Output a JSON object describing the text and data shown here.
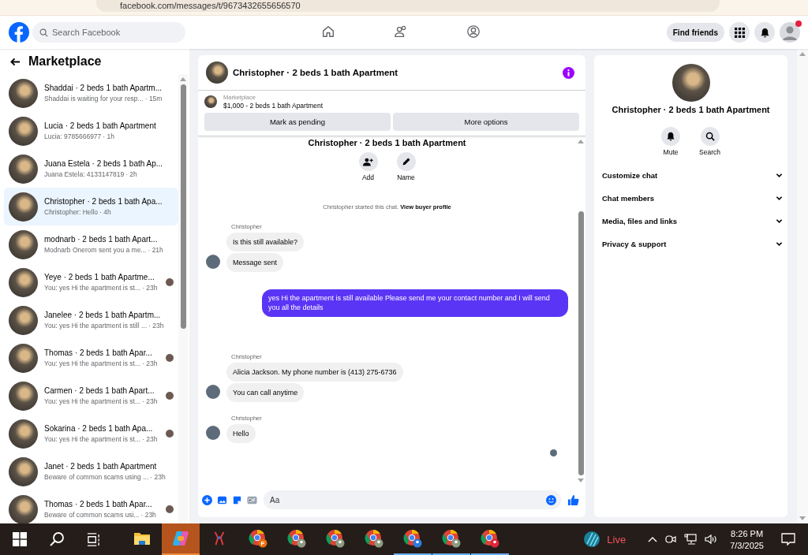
{
  "browser": {
    "url": "facebook.com/messages/t/9673432655656570"
  },
  "topbar": {
    "search": {
      "placeholder": "Search Facebook"
    },
    "nav": [
      {
        "selected": false
      },
      {
        "selected": false
      },
      {
        "selected": false
      }
    ],
    "find_friends": "Find friends",
    "notification_dot": true
  },
  "sidebar": {
    "title": "Marketplace",
    "conversations": [
      {
        "name": "Shaddai · 2 beds 1 bath Apartm...",
        "preview": "Shaddai is waiting for your resp...",
        "time": "· 15m",
        "selected": false,
        "seen": false
      },
      {
        "name": "Lucia · 2 beds 1 bath Apartment",
        "preview": "Lucia: 9785666977",
        "time": "· 1h",
        "selected": false,
        "seen": false
      },
      {
        "name": "Juana Estela · 2 beds 1 bath Ap...",
        "preview": "Juana Estela: 4133147819",
        "time": "· 2h",
        "selected": false,
        "seen": false
      },
      {
        "name": "Christopher · 2 beds 1 bath Apa...",
        "preview": "Christopher: Hello",
        "time": "· 4h",
        "selected": true,
        "seen": false
      },
      {
        "name": "modnarb · 2 beds 1 bath Apart...",
        "preview": "Modnarb Onerom sent you a me...",
        "time": "· 21h",
        "selected": false,
        "seen": false
      },
      {
        "name": "Yeye · 2 beds 1 bath Apartme...",
        "preview": "You: yes Hi the apartment is st...",
        "time": "· 23h",
        "selected": false,
        "seen": true
      },
      {
        "name": "Janelee · 2 beds 1 bath Apartm...",
        "preview": "You: yes Hi the apartment is still ...",
        "time": "· 23h",
        "selected": false,
        "seen": false
      },
      {
        "name": "Thomas · 2 beds 1 bath Apar...",
        "preview": "You: yes Hi the apartment is st...",
        "time": "· 23h",
        "selected": false,
        "seen": true
      },
      {
        "name": "Carmen · 2 beds 1 bath Apart...",
        "preview": "You: yes Hi the apartment is st...",
        "time": "· 23h",
        "selected": false,
        "seen": true
      },
      {
        "name": "Sokarina · 2 beds 1 bath Apa...",
        "preview": "You: yes Hi the apartment is st...",
        "time": "· 23h",
        "selected": false,
        "seen": true
      },
      {
        "name": "Janet · 2 beds 1 bath Apartment",
        "preview": "Beware of common scams using ...",
        "time": "· 23h",
        "selected": false,
        "seen": false
      },
      {
        "name": "Thomas · 2 beds 1 bath Apar...",
        "preview": "Beware of common scams usi...",
        "time": "· 23h",
        "selected": false,
        "seen": true
      }
    ]
  },
  "chat": {
    "title": "Christopher · 2 beds 1 bath Apartment",
    "listing": {
      "source": "Marketplace",
      "item": "$1,000 - 2 beds 1 bath Apartment"
    },
    "actions": [
      "Mark as pending",
      "More options"
    ],
    "intro": {
      "title": "Christopher · 2 beds 1 bath Apartment",
      "buttons": [
        "Add",
        "Name"
      ]
    },
    "system_note": {
      "text": "Christopher started this chat.",
      "link": "View buyer profile"
    },
    "messages": [
      {
        "kind": "incoming",
        "sender": "Christopher",
        "lines": [
          "Is this still available?",
          "Message sent"
        ]
      },
      {
        "kind": "outgoing",
        "lines": [
          "yes Hi the apartment is still available Please send me your contact number and I will send you all the details"
        ]
      },
      {
        "kind": "incoming",
        "sender": "Christopher",
        "lines": [
          "Alicia Jackson. My phone number is (413) 275-6736",
          "You can call anytime"
        ]
      },
      {
        "kind": "incoming",
        "sender": "Christopher",
        "lines": [
          "Hello"
        ]
      }
    ],
    "composer": {
      "placeholder": "Aa"
    }
  },
  "details": {
    "title": "Christopher · 2 beds 1 bath Apartment",
    "buttons": [
      "Mute",
      "Search"
    ],
    "sections": [
      {
        "label": "Customize chat",
        "expanded": false
      },
      {
        "label": "Chat members",
        "expanded": false
      },
      {
        "label": "Media, files and links",
        "expanded": false
      },
      {
        "label": "Privacy & support",
        "expanded": false
      }
    ]
  },
  "taskbar": {
    "apps": [
      {
        "kind": "explorer",
        "selected": false,
        "running": false
      },
      {
        "kind": "copilot",
        "selected": true,
        "running": false
      },
      {
        "kind": "tool",
        "selected": false,
        "running": false
      },
      {
        "kind": "browser",
        "badge": "F",
        "color": "#e8710a",
        "selected": false,
        "running": false
      },
      {
        "kind": "browser",
        "color": "#8d9c80",
        "selected": false,
        "running": false
      },
      {
        "kind": "browser",
        "color": "#8d9c80",
        "selected": false,
        "running": false
      },
      {
        "kind": "browser",
        "color": "#8d9c80",
        "selected": false,
        "running": false
      },
      {
        "kind": "browser",
        "color": "#2f7bdc",
        "selected": false,
        "running": true
      },
      {
        "kind": "browser",
        "color": "#8d9c80",
        "selected": false,
        "running": true
      },
      {
        "kind": "browser",
        "color": "#e0253a",
        "selected": false,
        "running": true
      }
    ],
    "weather": "Live",
    "time": "8:26 PM",
    "date": "7/3/2025"
  }
}
